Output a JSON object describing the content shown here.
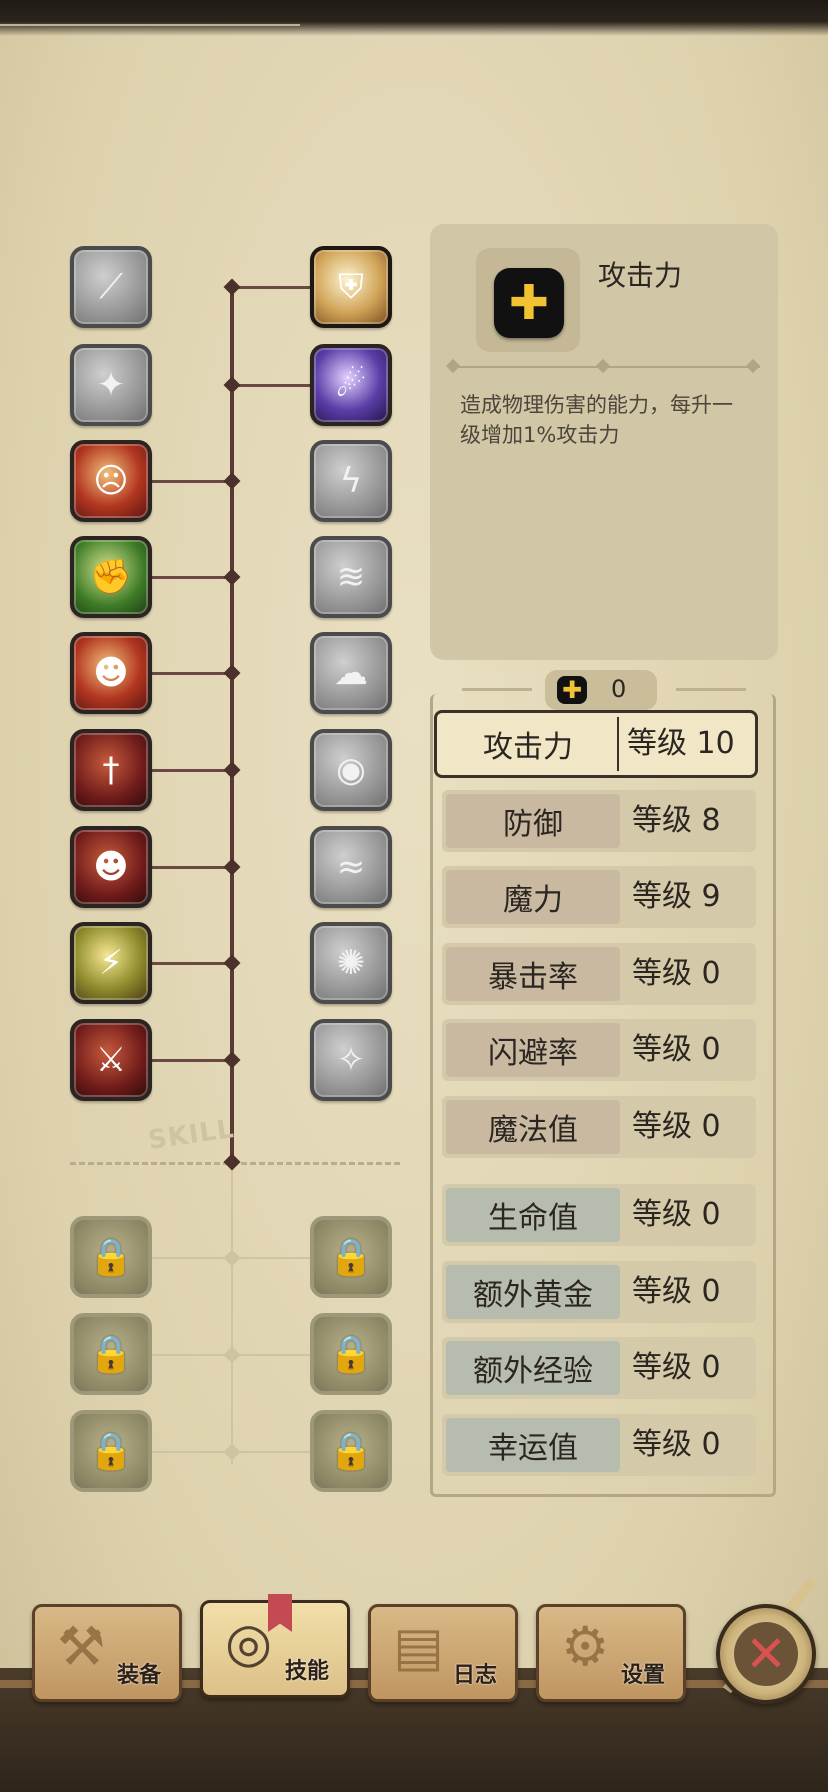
{
  "info": {
    "title": "攻击力",
    "description": "造成物理伤害的能力，每升一级增加1%攻击力",
    "icon": "plus-icon"
  },
  "points": {
    "value": "0",
    "icon": "plus-icon"
  },
  "stats": [
    {
      "name": "攻击力",
      "level": "等级 10",
      "selected": true
    },
    {
      "name": "防御",
      "level": "等级 8"
    },
    {
      "name": "魔力",
      "level": "等级 9"
    },
    {
      "name": "暴击率",
      "level": "等级 0"
    },
    {
      "name": "闪避率",
      "level": "等级 0"
    },
    {
      "name": "魔法值",
      "level": "等级 0"
    },
    {
      "name": "生命值",
      "level": "等级 0"
    },
    {
      "name": "额外黄金",
      "level": "等级 0"
    },
    {
      "name": "额外经验",
      "level": "等级 0"
    },
    {
      "name": "幸运值",
      "level": "等级 0"
    }
  ],
  "skill_tree": {
    "divider_label": "SKILL",
    "left_skills": [
      "slash-skill-icon",
      "dash-skill-icon",
      "rage-skill-icon",
      "strength-skill-icon",
      "shadow-slash-skill-icon",
      "dagger-skill-icon",
      "ninja-skill-icon",
      "fury-skill-icon",
      "greatsword-skill-icon"
    ],
    "right_skills": [
      "holy-shield-skill-icon",
      "dark-strike-skill-icon",
      "lightning-skill-icon",
      "charge-skill-icon",
      "smoke-skill-icon",
      "armor-skill-icon",
      "whirlwind-skill-icon",
      "curse-skill-icon",
      "stars-skill-icon"
    ],
    "locked_skills": 6
  },
  "nav": {
    "tabs": [
      {
        "label": "装备",
        "icon": "axe-icon"
      },
      {
        "label": "技能",
        "icon": "skill-ring-icon",
        "active": true
      },
      {
        "label": "日志",
        "icon": "journal-icon"
      },
      {
        "label": "设置",
        "icon": "gear-icon"
      }
    ],
    "close_icon": "close-icon"
  },
  "colors": {
    "accent": "#f1c232",
    "selected_border": "#3a3128",
    "close": "#d9524f"
  }
}
